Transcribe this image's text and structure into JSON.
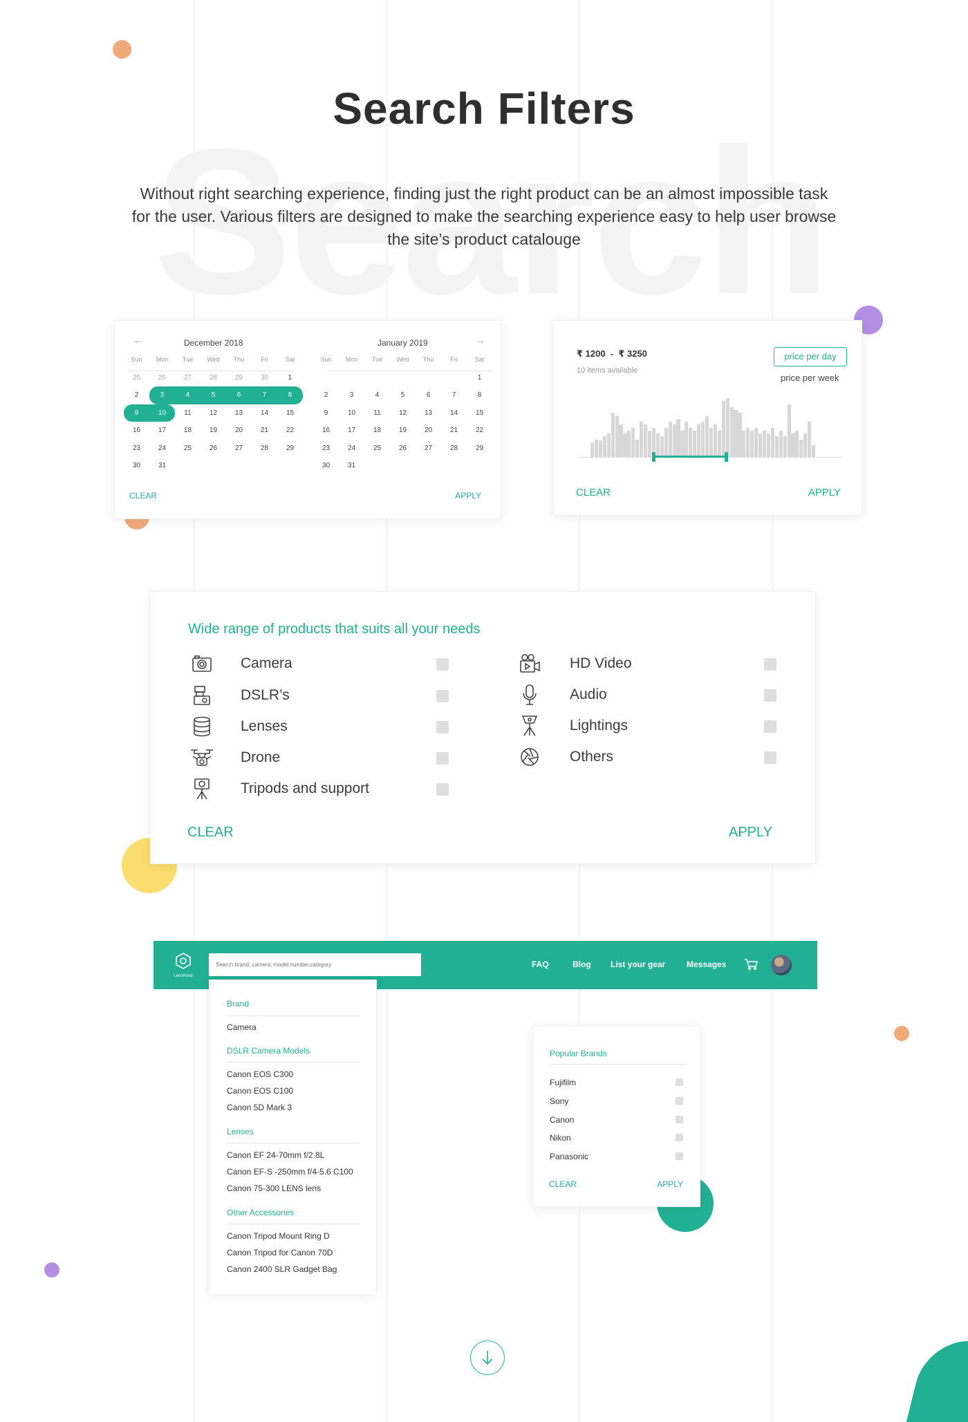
{
  "page": {
    "watermark": "Search",
    "title": "Search Filters",
    "intro": "Without right searching experience, finding just the right product can be an almost impossible task for the user.  Various filters are designed to make the searching experience easy to help user browse the site’s product catalouge"
  },
  "colors": {
    "accent": "#22b095",
    "orange": "#f0aa7a",
    "purple": "#b38fe3",
    "yellow": "#fbdd6f"
  },
  "calendar": {
    "months": [
      {
        "name": "December 2018",
        "weekdays": [
          "Sun",
          "Mon",
          "Tue",
          "Wed",
          "Thu",
          "Fri",
          "Sat"
        ],
        "weeks": [
          [
            "25",
            "26",
            "27",
            "28",
            "29",
            "30",
            "1"
          ],
          [
            "2",
            "3",
            "4",
            "5",
            "6",
            "7",
            "8"
          ],
          [
            "9",
            "10",
            "11",
            "12",
            "13",
            "14",
            "15"
          ],
          [
            "16",
            "17",
            "18",
            "19",
            "20",
            "21",
            "22"
          ],
          [
            "23",
            "24",
            "25",
            "26",
            "27",
            "28",
            "29"
          ],
          [
            "30",
            "31",
            "",
            "",
            "",
            "",
            ""
          ]
        ]
      },
      {
        "name": "January 2019",
        "weekdays": [
          "Sun",
          "Mon",
          "Tue",
          "Wed",
          "Thu",
          "Fri",
          "Sat"
        ],
        "weeks": [
          [
            "",
            "",
            "",
            "",
            "",
            "",
            "1"
          ],
          [
            "2",
            "3",
            "4",
            "5",
            "6",
            "7",
            "8"
          ],
          [
            "9",
            "10",
            "11",
            "12",
            "13",
            "14",
            "15"
          ],
          [
            "16",
            "17",
            "18",
            "19",
            "20",
            "21",
            "22"
          ],
          [
            "23",
            "24",
            "25",
            "26",
            "27",
            "28",
            "29"
          ],
          [
            "30",
            "31",
            "",
            "",
            "",
            "",
            ""
          ]
        ]
      }
    ],
    "selected_range": "December 3 – December 10, 2018",
    "clear_label": "CLEAR",
    "apply_label": "APPLY",
    "prev_icon": "arrow-left-icon",
    "next_icon": "arrow-right-icon"
  },
  "price": {
    "range_label": "₹ 1200  -  ₹ 3250",
    "available": "10 items available",
    "option_active": "price per day",
    "option_other": "price per week",
    "histogram": [
      0.25,
      0.3,
      0.28,
      0.35,
      0.4,
      0.75,
      0.7,
      0.55,
      0.4,
      0.45,
      0.5,
      0.3,
      0.6,
      0.55,
      0.45,
      0.5,
      0.4,
      0.35,
      0.5,
      0.6,
      0.55,
      0.65,
      0.45,
      0.6,
      0.5,
      0.45,
      0.55,
      0.6,
      0.7,
      0.5,
      0.55,
      0.45,
      0.95,
      1.0,
      0.85,
      0.8,
      0.75,
      0.45,
      0.5,
      0.45,
      0.5,
      0.4,
      0.45,
      0.4,
      0.5,
      0.35,
      0.45,
      0.35,
      0.9,
      0.4,
      0.45,
      0.3,
      0.4,
      0.6,
      0.2
    ],
    "slider_min": 0.28,
    "slider_max": 0.6,
    "clear_label": "CLEAR",
    "apply_label": "APPLY"
  },
  "products": {
    "heading": "Wide range of products that suits all your needs",
    "left": [
      {
        "label": "Camera",
        "icon": "camera-icon"
      },
      {
        "label": "DSLR’s",
        "icon": "dslr-icon"
      },
      {
        "label": "Lenses",
        "icon": "lens-icon"
      },
      {
        "label": "Drone",
        "icon": "drone-icon"
      },
      {
        "label": "Tripods and support",
        "icon": "tripod-icon"
      }
    ],
    "right": [
      {
        "label": "HD Video",
        "icon": "video-camera-icon"
      },
      {
        "label": "Audio",
        "icon": "microphone-icon"
      },
      {
        "label": "Lightings",
        "icon": "lighting-icon"
      },
      {
        "label": "Others",
        "icon": "aperture-icon"
      }
    ],
    "clear_label": "CLEAR",
    "apply_label": "APPLY"
  },
  "nav": {
    "logo_text": "LensHood",
    "search_placeholder": "Search brand, camera, model number,category",
    "links": [
      "FAQ",
      "Blog",
      "List your gear",
      "Messages"
    ],
    "cart_icon": "cart-icon",
    "avatar_icon": "avatar"
  },
  "dropdown": {
    "groups": [
      {
        "heading": "Brand",
        "items": [
          "Camera"
        ]
      },
      {
        "heading": "DSLR Camera Models",
        "items": [
          "Canon EOS C300",
          "Canon EOS C100",
          "Canon 5D Mark 3"
        ]
      },
      {
        "heading": "Lenses",
        "items": [
          "Canon EF 24-70mm f/2.8L",
          "Canon EF-S -250mm f/4-5.6 C100",
          "Canon 75-300 LENS lens"
        ]
      },
      {
        "heading": "Other Accessories",
        "items": [
          "Canon Tripod Mount Ring D",
          "Canon Tripod for Canon 70D",
          "Canon 2400 SLR Gadget Bag"
        ]
      }
    ]
  },
  "brands": {
    "heading": "Popular Brands",
    "items": [
      "Fujifilm",
      "Sony",
      "Canon",
      "Nikon",
      "Panasonic"
    ],
    "clear_label": "CLEAR",
    "apply_label": "APPLY"
  },
  "scroll_icon": "arrow-down-icon"
}
